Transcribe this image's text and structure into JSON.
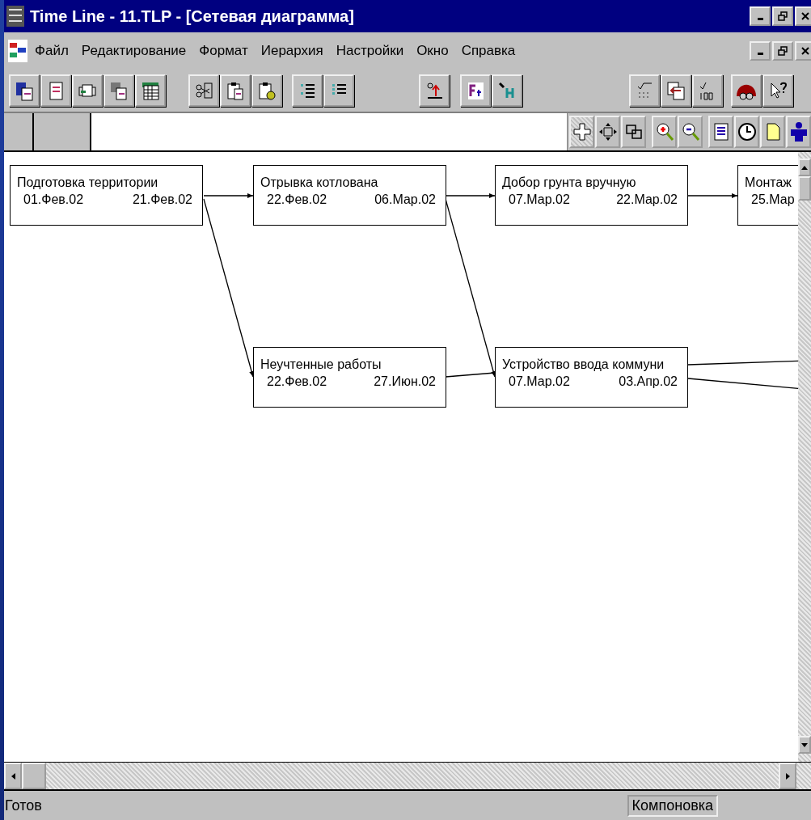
{
  "window": {
    "title": "Time Line - 11.TLP - [Сетевая диаграмма]"
  },
  "menu": [
    {
      "label": "Файл"
    },
    {
      "label": "Редактирование"
    },
    {
      "label": "Формат"
    },
    {
      "label": "Иерархия"
    },
    {
      "label": "Настройки"
    },
    {
      "label": "Окно"
    },
    {
      "label": "Справка"
    }
  ],
  "diagram": {
    "nodes": [
      {
        "name": "Подготовка территории",
        "start": "01.Фев.02",
        "finish": "21.Фев.02"
      },
      {
        "name": "Отрывка котлована",
        "start": "22.Фев.02",
        "finish": "06.Мар.02"
      },
      {
        "name": "Добор грунта вручную",
        "start": "07.Мар.02",
        "finish": "22.Мар.02"
      },
      {
        "name": "Монтаж",
        "start": "25.Мар"
      },
      {
        "name": "Неучтенные работы",
        "start": "22.Фев.02",
        "finish": "27.Июн.02"
      },
      {
        "name": "Устройство ввода коммуни",
        "start": "07.Мар.02",
        "finish": "03.Апр.02"
      }
    ]
  },
  "status_bar": {
    "text": "Готов",
    "panel": "Компоновка"
  }
}
